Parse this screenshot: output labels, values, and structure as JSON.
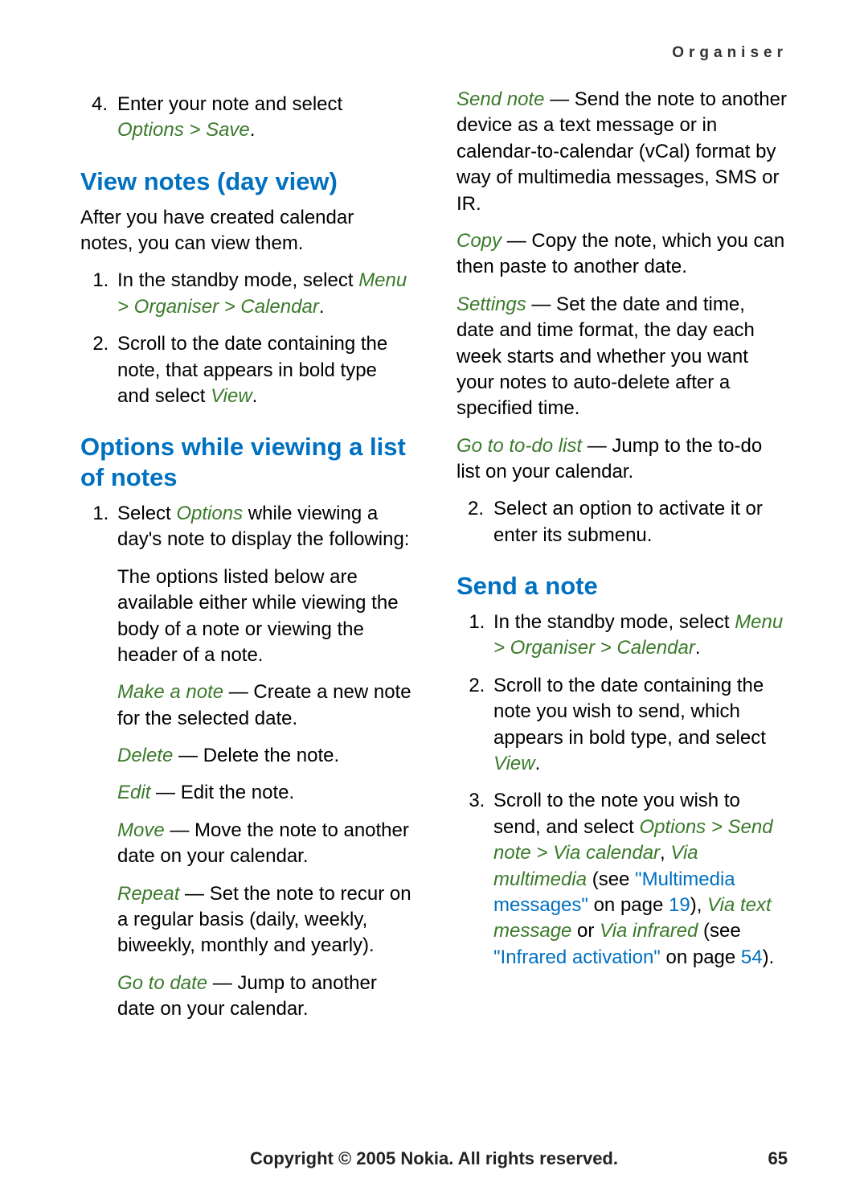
{
  "header": {
    "section": "Organiser"
  },
  "footer": {
    "copyright": "Copyright © 2005 Nokia. All rights reserved.",
    "page": "65"
  },
  "left": {
    "step4_pre": "Enter your note and select ",
    "step4_path": "Options > Save",
    "step4_post": ".",
    "h_view": "View notes (day view)",
    "view_intro": "After you have created calendar notes, you can view them.",
    "view_s1_pre": "In the standby mode, select ",
    "view_s1_path": "Menu > Organiser > Calendar",
    "view_s1_post": ".",
    "view_s2_pre": "Scroll to the date containing the note, that appears in bold type and select ",
    "view_s2_cmd": "View",
    "view_s2_post": ".",
    "h_opts": "Options while viewing a list of notes",
    "opts_s1_pre": "Select ",
    "opts_s1_cmd": "Options",
    "opts_s1_post": " while viewing a day's note to display the following:",
    "opts_s1_p2": "The options listed below are available either while viewing the body of a note or viewing the header of a note.",
    "opt_make_label": "Make a note",
    "opt_make_desc": " — Create a new note for the selected date.",
    "opt_delete_label": "Delete",
    "opt_delete_desc": " — Delete the note.",
    "opt_edit_label": "Edit",
    "opt_edit_desc": " — Edit the note.",
    "opt_move_label": "Move",
    "opt_move_desc": " — Move the note to another date on your calendar.",
    "opt_repeat_label": "Repeat",
    "opt_repeat_desc": " — Set the note to recur on a regular basis (daily, weekly, biweekly, monthly and yearly).",
    "opt_gotodate_label": "Go to date",
    "opt_gotodate_desc": " — Jump to another date on your calendar."
  },
  "right": {
    "opt_sendnote_label": "Send note",
    "opt_sendnote_desc": " — Send the note to another device as a text message or in calendar-to-calendar (vCal) format by way of multimedia messages, SMS or IR.",
    "opt_copy_label": "Copy",
    "opt_copy_desc": " — Copy the note, which you can then paste to another date.",
    "opt_settings_label": "Settings",
    "opt_settings_desc": " — Set the date and time, date and time format, the day each week starts and whether you want your notes to auto-delete after a specified time.",
    "opt_gototodo_label": "Go to to-do list",
    "opt_gototodo_desc": " — Jump to the to-do list on your calendar.",
    "opts_step2": "Select an option to activate it or enter its submenu.",
    "h_send": "Send a note",
    "send_s1_pre": "In the standby mode, select ",
    "send_s1_path": "Menu > Organiser > Calendar",
    "send_s1_post": ".",
    "send_s2_pre": "Scroll to the date containing the note you wish to send, which appears in bold type, and select ",
    "send_s2_cmd": "View",
    "send_s2_post": ".",
    "send_s3_pre": "Scroll to the note you wish to send, and select ",
    "send_s3_path1": "Options > Send note > Via calendar",
    "send_s3_comma": ", ",
    "send_s3_path2": "Via multimedia",
    "send_s3_see1_pre": " (see ",
    "send_s3_link1": "\"Multimedia messages\"",
    "send_s3_see1_mid": " on page ",
    "send_s3_page1": "19",
    "send_s3_paren1": "), ",
    "send_s3_path3": "Via text message",
    "send_s3_or": " or ",
    "send_s3_path4": "Via infrared",
    "send_s3_see2_pre": " (see ",
    "send_s3_link2": "\"Infrared activation\"",
    "send_s3_see2_mid": " on page ",
    "send_s3_page2": "54",
    "send_s3_paren2": ")."
  }
}
